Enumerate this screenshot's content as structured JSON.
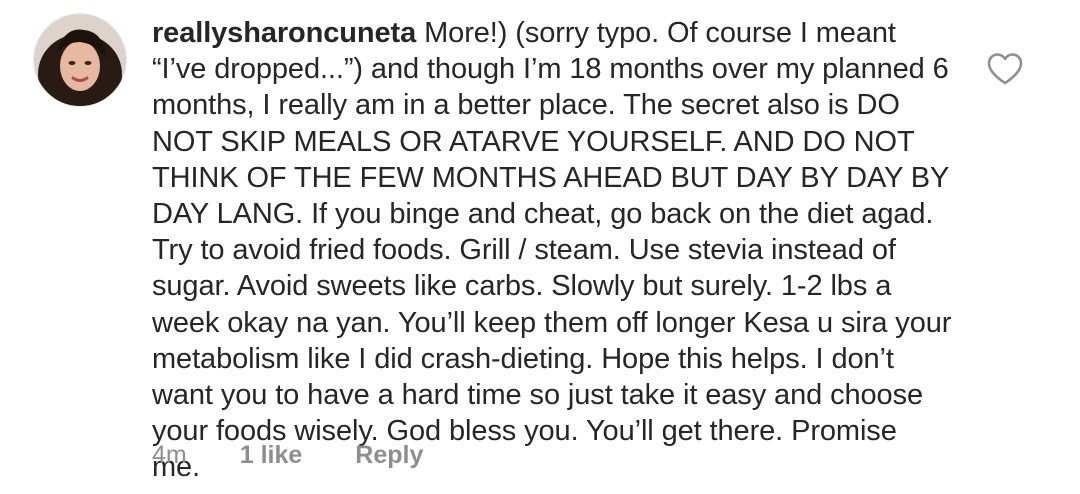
{
  "comment": {
    "username": "reallysharoncuneta",
    "text": "More!) (sorry typo. Of course I meant “I’ve dropped...”) and though I’m 18 months over my planned 6 months, I really am in a better place. The secret also is DO NOT SKIP MEALS OR ATARVE YOURSELF. AND DO NOT THINK OF THE FEW MONTHS AHEAD BUT DAY BY DAY BY DAY LANG. If you binge and cheat, go back on the diet agad. Try to avoid fried foods. Grill / steam. Use stevia instead of sugar. Avoid sweets like carbs. Slowly but surely. 1-2 lbs a week okay na yan. You’ll keep them off longer Kesa u sira your metabolism like I did crash-dieting. Hope this helps. I don’t want you to have a hard time so just take it easy and choose your foods wisely. God bless you. You’ll get there. Promise me.",
    "time": "4m",
    "likes": "1 like",
    "reply_label": "Reply",
    "like_icon": "heart-outline-icon"
  },
  "colors": {
    "text": "#262626",
    "secondary_text": "#8e8e8e",
    "background": "#ffffff"
  }
}
